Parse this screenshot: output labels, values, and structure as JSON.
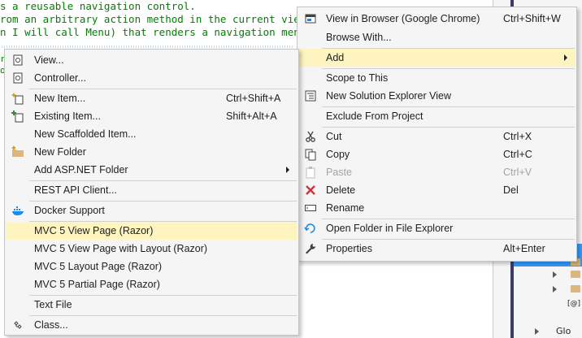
{
  "editor": {
    "lines": [
      "s a reusable navigation control.",
      "rom an arbitrary action method in the current view.",
      "n I will call Menu) that renders a navigation menu."
    ],
    "fragments": [
      "r",
      "o",
      "."
    ]
  },
  "solution_explorer": {
    "fragments": [
      "[@]",
      "Glo"
    ]
  },
  "context_menu_right": {
    "items": [
      {
        "label": "View in Browser (Google Chrome)",
        "shortcut": "Ctrl+Shift+W",
        "icon": "browser-view-icon"
      },
      {
        "label": "Browse With...",
        "shortcut": ""
      },
      {
        "label": "Add",
        "shortcut": "",
        "submenu": true,
        "highlighted": true
      },
      {
        "label": "Scope to This",
        "shortcut": ""
      },
      {
        "label": "New Solution Explorer View",
        "shortcut": "",
        "icon": "new-view-icon"
      },
      {
        "label": "Exclude From Project",
        "shortcut": ""
      },
      {
        "label": "Cut",
        "shortcut": "Ctrl+X",
        "icon": "scissors-icon"
      },
      {
        "label": "Copy",
        "shortcut": "Ctrl+C",
        "icon": "copy-icon"
      },
      {
        "label": "Paste",
        "shortcut": "Ctrl+V",
        "icon": "paste-icon",
        "disabled": true
      },
      {
        "label": "Delete",
        "shortcut": "Del",
        "icon": "delete-x-icon"
      },
      {
        "label": "Rename",
        "shortcut": "",
        "icon": "rename-icon"
      },
      {
        "label": "Open Folder in File Explorer",
        "shortcut": "",
        "icon": "open-folder-icon"
      },
      {
        "label": "Properties",
        "shortcut": "Alt+Enter",
        "icon": "wrench-icon"
      }
    ]
  },
  "context_menu_left": {
    "items": [
      {
        "label": "View...",
        "shortcut": "",
        "icon": "view-icon"
      },
      {
        "label": "Controller...",
        "shortcut": "",
        "icon": "controller-icon"
      },
      {
        "label": "New Item...",
        "shortcut": "Ctrl+Shift+A",
        "icon": "new-item-icon"
      },
      {
        "label": "Existing Item...",
        "shortcut": "Shift+Alt+A",
        "icon": "existing-item-icon"
      },
      {
        "label": "New Scaffolded Item...",
        "shortcut": ""
      },
      {
        "label": "New Folder",
        "shortcut": "",
        "icon": "new-folder-icon"
      },
      {
        "label": "Add ASP.NET Folder",
        "shortcut": "",
        "submenu": true
      },
      {
        "label": "REST API Client...",
        "shortcut": ""
      },
      {
        "label": "Docker Support",
        "shortcut": "",
        "icon": "docker-icon"
      },
      {
        "label": "MVC 5 View Page (Razor)",
        "shortcut": "",
        "highlighted": true
      },
      {
        "label": "MVC 5 View Page with Layout (Razor)",
        "shortcut": ""
      },
      {
        "label": "MVC 5 Layout Page (Razor)",
        "shortcut": ""
      },
      {
        "label": "MVC 5 Partial Page (Razor)",
        "shortcut": ""
      },
      {
        "label": "Text File",
        "shortcut": ""
      },
      {
        "label": "Class...",
        "shortcut": "",
        "icon": "class-icon"
      }
    ]
  },
  "colors": {
    "highlight": "#fdf4bf",
    "menu_background": "#f5f5f5",
    "code_comment": "#008000",
    "selection_blue": "#3399ff",
    "delete_red": "#d13438"
  }
}
